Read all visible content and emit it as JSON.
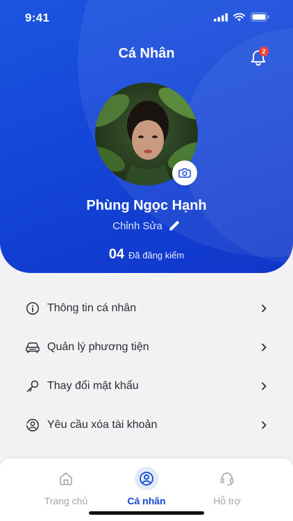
{
  "status_bar": {
    "time": "9:41"
  },
  "header": {
    "title": "Cá Nhân",
    "notification_count": "2"
  },
  "profile": {
    "name": "Phùng Ngọc Hạnh",
    "edit_label": "Chỉnh Sửa",
    "inspection_count": "04",
    "inspection_label": "Đã đăng kiểm"
  },
  "menu": {
    "items": [
      {
        "label": "Thông tin cá nhân",
        "icon": "info-icon"
      },
      {
        "label": "Quản lý phương tiện",
        "icon": "car-icon"
      },
      {
        "label": "Thay đổi mật khẩu",
        "icon": "key-icon"
      },
      {
        "label": "Yêu cầu xóa tài khoản",
        "icon": "user-remove-icon"
      }
    ]
  },
  "tabbar": {
    "tabs": [
      {
        "label": "Trang chủ",
        "icon": "home-icon",
        "active": false
      },
      {
        "label": "Cá nhân",
        "icon": "user-circle-icon",
        "active": true
      },
      {
        "label": "Hỗ trợ",
        "icon": "headset-icon",
        "active": false
      }
    ]
  },
  "colors": {
    "primary": "#1448d6",
    "badge": "#f0443a",
    "background": "#f2f2f4"
  }
}
